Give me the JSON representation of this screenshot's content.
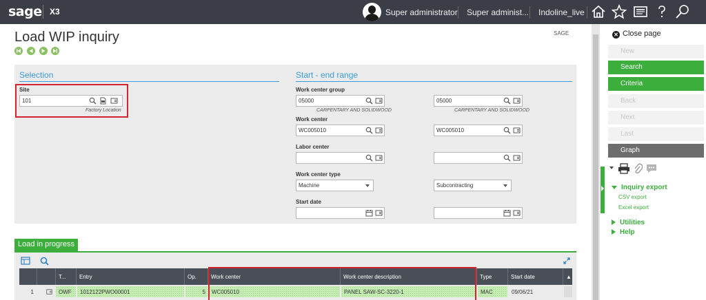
{
  "topbar": {
    "logo": "sage",
    "product": "X3",
    "user": "Super administrator",
    "role": "Super administ...",
    "folder": "Indoline_live",
    "icons": [
      "home-icon",
      "star-icon",
      "news-icon",
      "help-icon",
      "search-icon"
    ]
  },
  "page": {
    "title": "Load WIP inquiry",
    "tag": "SAGE",
    "nav_icons": [
      "first-record-icon",
      "previous-record-icon",
      "next-record-icon",
      "last-record-icon"
    ]
  },
  "selection": {
    "title": "Selection",
    "site_label": "Site",
    "site_value": "101",
    "site_desc": "Factory Location"
  },
  "range": {
    "title": "Start - end range",
    "wcg_label": "Work center group",
    "wcg_from": "05000",
    "wcg_to": "05000",
    "wcg_from_desc": "CARPENTARY AND SOLIDWOOD",
    "wcg_to_desc": "CARPENTARY AND SOLIDWOOD",
    "wc_label": "Work center",
    "wc_from": "WC005010",
    "wc_to": "WC005010",
    "lc_label": "Labor center",
    "lc_from": "",
    "lc_to": "",
    "wct_label": "Work center type",
    "wct_from": "Machine",
    "wct_to": "Subcontracting",
    "sd_label": "Start date",
    "sd_from": "",
    "sd_to": ""
  },
  "grid": {
    "tab_label": "Load in progress",
    "columns": [
      "T...",
      "Entry",
      "Op.",
      "Work center",
      "Work center description",
      "Type",
      "Start date"
    ],
    "rows": [
      {
        "num": "1",
        "type": "OWF",
        "entry": "1012122PWO00001",
        "op": "5",
        "work_center": "WC005010",
        "wc_desc": "PANEL SAW-SC-3220-1",
        "wc_type": "MAC",
        "start_date": "09/06/21"
      }
    ]
  },
  "sidebar": {
    "close_page": "Close page",
    "new": "New",
    "search": "Search",
    "criteria": "Criteria",
    "back": "Back",
    "next": "Next",
    "last": "Last",
    "graph": "Graph",
    "inquiry_export": "Inquiry export",
    "csv_export": "CSV export",
    "excel_export": "Excel export",
    "utilities": "Utilities",
    "help": "Help"
  },
  "colors": {
    "topbar": "#3b3e46",
    "accent_green": "#3cae3c",
    "section_blue": "#3a9ad9",
    "highlight_red": "#d2232a"
  }
}
